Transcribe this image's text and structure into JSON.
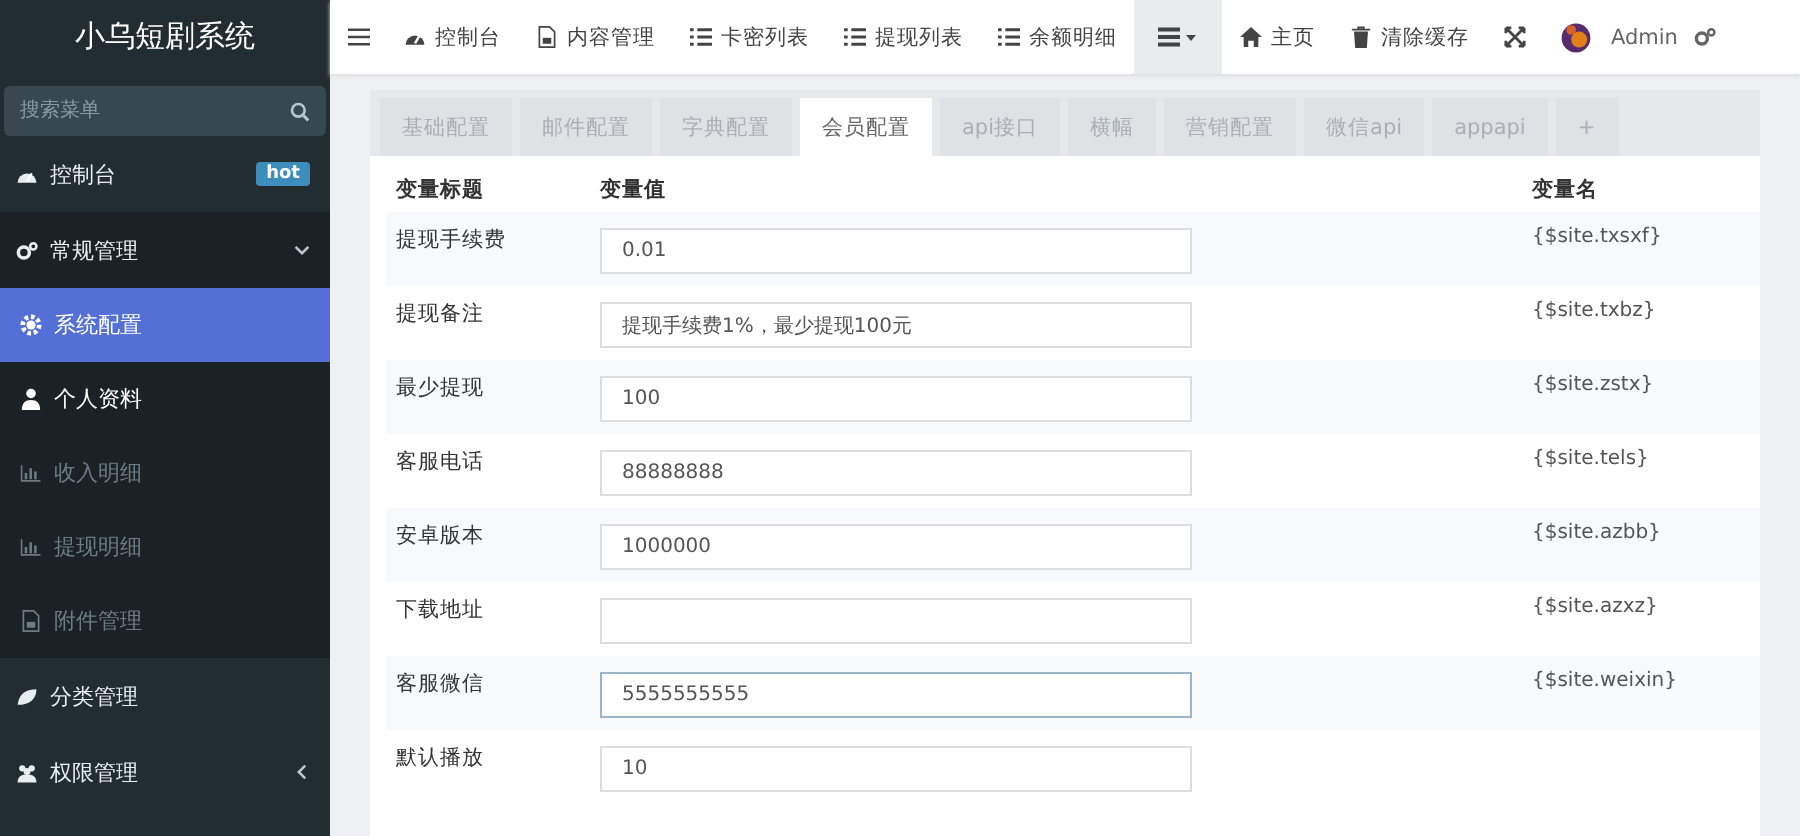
{
  "sidebar": {
    "logo": "小乌短剧系统",
    "search": {
      "placeholder": "搜索菜单"
    },
    "items": [
      {
        "label": "控制台",
        "badge": "hot",
        "selected": false
      },
      {
        "label": "常规管理",
        "expanded": true,
        "selected": false,
        "children": [
          {
            "label": "系统配置",
            "selected": true,
            "disabled": false
          },
          {
            "label": "个人资料",
            "selected": false,
            "disabled": false
          },
          {
            "label": "收入明细",
            "selected": false,
            "disabled": true
          },
          {
            "label": "提现明细",
            "selected": false,
            "disabled": true
          },
          {
            "label": "附件管理",
            "selected": false,
            "disabled": true
          }
        ]
      },
      {
        "label": "分类管理",
        "selected": false
      },
      {
        "label": "权限管理",
        "expanded": false,
        "selected": false
      }
    ]
  },
  "topbar": {
    "nav": [
      {
        "label": "控制台"
      },
      {
        "label": "内容管理"
      },
      {
        "label": "卡密列表"
      },
      {
        "label": "提现列表"
      },
      {
        "label": "余额明细"
      }
    ],
    "dropdown": {
      "active": true
    },
    "right": [
      {
        "label": "主页"
      },
      {
        "label": "清除缓存"
      }
    ],
    "user": "Admin"
  },
  "tabs": [
    {
      "label": "基础配置",
      "selected": false
    },
    {
      "label": "邮件配置",
      "selected": false
    },
    {
      "label": "字典配置",
      "selected": false
    },
    {
      "label": "会员配置",
      "selected": true
    },
    {
      "label": "api接口",
      "selected": false
    },
    {
      "label": "横幅",
      "selected": false
    },
    {
      "label": "营销配置",
      "selected": false
    },
    {
      "label": "微信api",
      "selected": false
    },
    {
      "label": "appapi",
      "selected": false
    },
    {
      "label": "+",
      "selected": false
    }
  ],
  "table": {
    "columns": [
      "变量标题",
      "变量值",
      "变量名"
    ],
    "rows": [
      {
        "title": "提现手续费",
        "value": "0.01",
        "var": "{$site.txsxf}",
        "focused": false
      },
      {
        "title": "提现备注",
        "value": "提现手续费1%，最少提现100元",
        "var": "{$site.txbz}",
        "focused": false
      },
      {
        "title": "最少提现",
        "value": "100",
        "var": "{$site.zstx}",
        "focused": false
      },
      {
        "title": "客服电话",
        "value": "88888888",
        "var": "{$site.tels}",
        "focused": false
      },
      {
        "title": "安卓版本",
        "value": "1000000",
        "var": "{$site.azbb}",
        "focused": false
      },
      {
        "title": "下载地址",
        "value": "",
        "var": "{$site.azxz}",
        "focused": false
      },
      {
        "title": "客服微信",
        "value": "5555555555",
        "var": "{$site.weixin}",
        "focused": true
      },
      {
        "title": "默认播放",
        "value": "10",
        "focused": false
      }
    ]
  }
}
